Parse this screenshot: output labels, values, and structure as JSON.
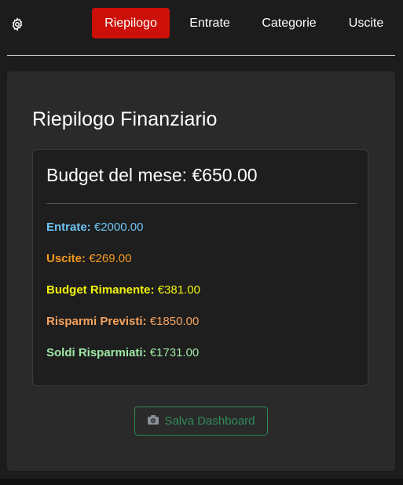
{
  "nav": {
    "settings_icon": "gear-icon",
    "tabs": [
      {
        "label": "Riepilogo",
        "active": true
      },
      {
        "label": "Entrate",
        "active": false
      },
      {
        "label": "Categorie",
        "active": false
      },
      {
        "label": "Uscite",
        "active": false
      }
    ],
    "active_color": "#cc0f08"
  },
  "summary": {
    "title": "Riepilogo Finanziario",
    "budget_title": "Budget del mese: €650.00",
    "stats": {
      "entrate": {
        "label": "Entrate:",
        "value": "€2000.00",
        "color": "#6cc4f5"
      },
      "uscite": {
        "label": "Uscite:",
        "value": "€269.00",
        "color": "#f39a1e"
      },
      "budget_rimanente": {
        "label": "Budget Rimanente:",
        "value": "€381.00",
        "color": "#f2f20c"
      },
      "risparmi_previsti": {
        "label": "Risparmi Previsti:",
        "value": "€1850.00",
        "color": "#f7a35e"
      },
      "soldi_risparmiati": {
        "label": "Soldi Risparmiati:",
        "value": "€1731.00",
        "color": "#9ee8a4"
      }
    }
  },
  "actions": {
    "save_label": "Salva Dashboard",
    "save_icon": "camera-icon",
    "save_color": "#2f8a57"
  }
}
